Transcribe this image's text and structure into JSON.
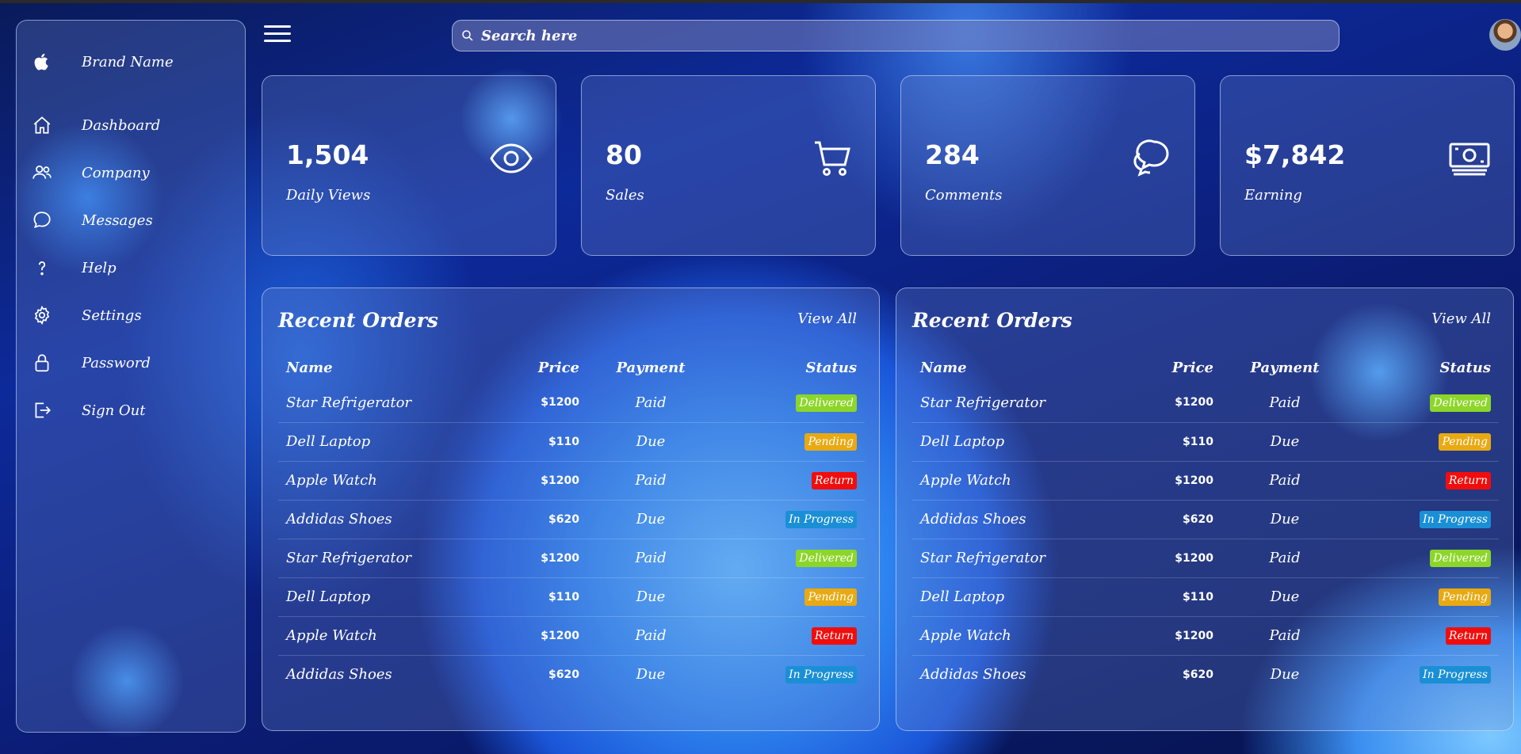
{
  "brand": {
    "name": "Brand Name"
  },
  "nav": [
    {
      "label": "Dashboard",
      "icon": "home-icon"
    },
    {
      "label": "Company",
      "icon": "users-icon"
    },
    {
      "label": "Messages",
      "icon": "chat-icon"
    },
    {
      "label": "Help",
      "icon": "question-icon"
    },
    {
      "label": "Settings",
      "icon": "gear-icon"
    },
    {
      "label": "Password",
      "icon": "lock-icon"
    },
    {
      "label": "Sign Out",
      "icon": "sign-out-icon"
    }
  ],
  "search": {
    "placeholder": "Search here"
  },
  "cards": [
    {
      "value": "1,504",
      "label": "Daily Views",
      "icon": "eye-icon"
    },
    {
      "value": "80",
      "label": "Sales",
      "icon": "cart-icon"
    },
    {
      "value": "284",
      "label": "Comments",
      "icon": "comments-icon"
    },
    {
      "value": "$7,842",
      "label": "Earning",
      "icon": "money-icon"
    }
  ],
  "orders_left": {
    "title": "Recent Orders",
    "view_all": "View All",
    "headers": {
      "name": "Name",
      "price": "Price",
      "payment": "Payment",
      "status": "Status"
    },
    "rows": [
      {
        "name": "Star Refrigerator",
        "price": "$1200",
        "payment": "Paid",
        "status": "Delivered"
      },
      {
        "name": "Dell Laptop",
        "price": "$110",
        "payment": "Due",
        "status": "Pending"
      },
      {
        "name": "Apple Watch",
        "price": "$1200",
        "payment": "Paid",
        "status": "Return"
      },
      {
        "name": "Addidas Shoes",
        "price": "$620",
        "payment": "Due",
        "status": "In Progress"
      },
      {
        "name": "Star Refrigerator",
        "price": "$1200",
        "payment": "Paid",
        "status": "Delivered"
      },
      {
        "name": "Dell Laptop",
        "price": "$110",
        "payment": "Due",
        "status": "Pending"
      },
      {
        "name": "Apple Watch",
        "price": "$1200",
        "payment": "Paid",
        "status": "Return"
      },
      {
        "name": "Addidas Shoes",
        "price": "$620",
        "payment": "Due",
        "status": "In Progress"
      }
    ]
  },
  "orders_right": {
    "title": "Recent Orders",
    "view_all": "View All",
    "headers": {
      "name": "Name",
      "price": "Price",
      "payment": "Payment",
      "status": "Status"
    },
    "rows": [
      {
        "name": "Star Refrigerator",
        "price": "$1200",
        "payment": "Paid",
        "status": "Delivered"
      },
      {
        "name": "Dell Laptop",
        "price": "$110",
        "payment": "Due",
        "status": "Pending"
      },
      {
        "name": "Apple Watch",
        "price": "$1200",
        "payment": "Paid",
        "status": "Return"
      },
      {
        "name": "Addidas Shoes",
        "price": "$620",
        "payment": "Due",
        "status": "In Progress"
      },
      {
        "name": "Star Refrigerator",
        "price": "$1200",
        "payment": "Paid",
        "status": "Delivered"
      },
      {
        "name": "Dell Laptop",
        "price": "$110",
        "payment": "Due",
        "status": "Pending"
      },
      {
        "name": "Apple Watch",
        "price": "$1200",
        "payment": "Paid",
        "status": "Return"
      },
      {
        "name": "Addidas Shoes",
        "price": "$620",
        "payment": "Due",
        "status": "In Progress"
      }
    ]
  },
  "status_colors": {
    "Delivered": "#8cd629",
    "Pending": "#e8a912",
    "Return": "#f20d0d",
    "In Progress": "#1a8fd6"
  }
}
